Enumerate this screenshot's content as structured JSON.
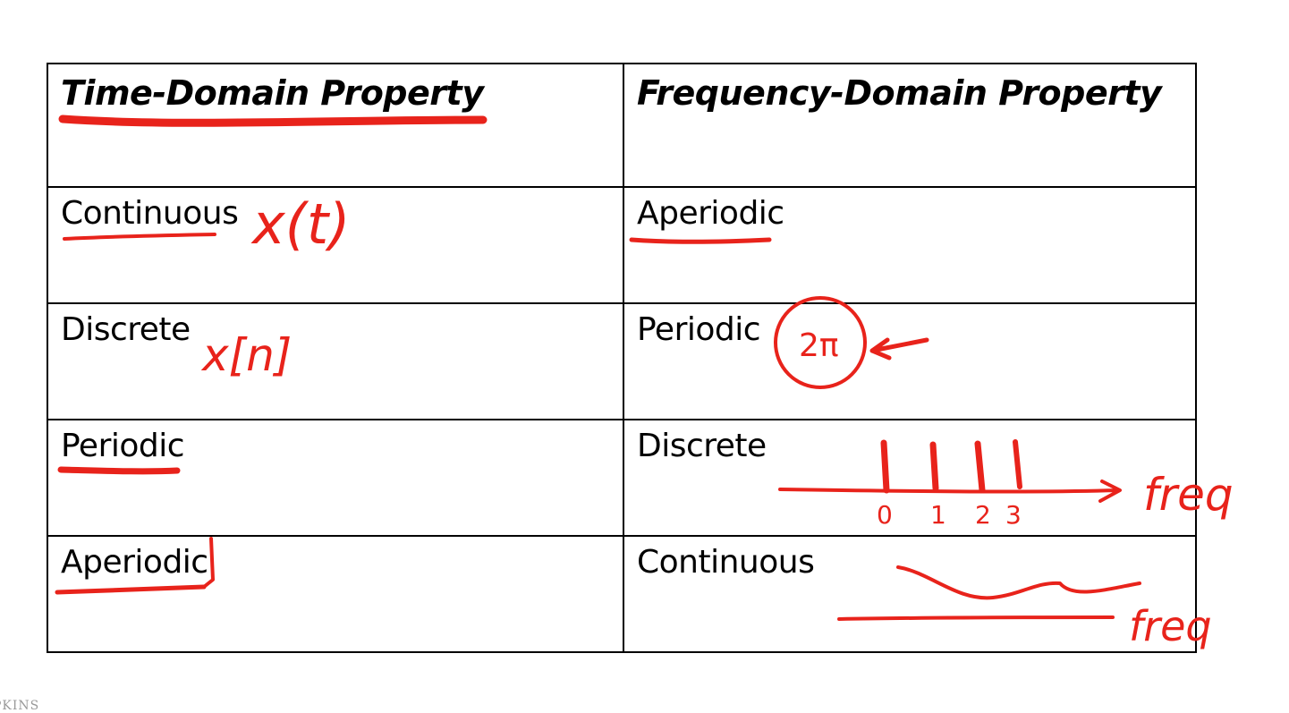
{
  "table": {
    "header": {
      "left": "Time-Domain Property",
      "right": "Frequency-Domain Property"
    },
    "rows": [
      {
        "left": "Continuous",
        "right": "Aperiodic"
      },
      {
        "left": "Discrete",
        "right": "Periodic"
      },
      {
        "left": "Periodic",
        "right": "Discrete"
      },
      {
        "left": "Aperiodic",
        "right": "Continuous"
      }
    ]
  },
  "annotations": {
    "continuous_signal": "x(t)",
    "discrete_signal": "x[n]",
    "period": "2π",
    "freq_axis_label_1": "freq",
    "freq_axis_label_2": "freq",
    "tick_labels": [
      "0",
      "1",
      "2",
      "3"
    ],
    "ink_color": "#e8231b"
  },
  "footer": {
    "text": "PKINS"
  }
}
